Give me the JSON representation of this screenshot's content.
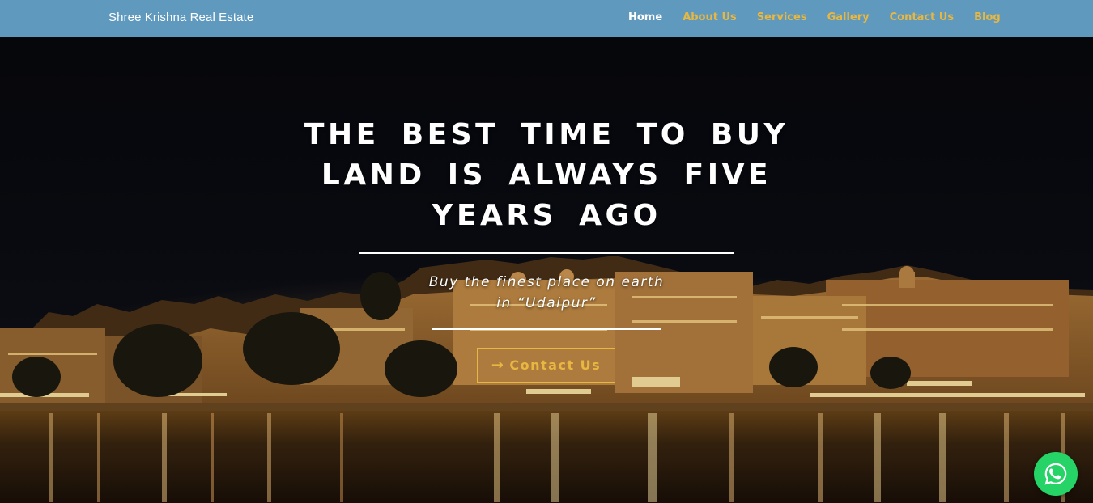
{
  "header": {
    "brand": "Shree Krishna Real Estate",
    "nav": [
      {
        "label": "Home",
        "active": true
      },
      {
        "label": "About Us",
        "active": false
      },
      {
        "label": "Services",
        "active": false
      },
      {
        "label": "Gallery",
        "active": false
      },
      {
        "label": "Contact Us",
        "active": false
      },
      {
        "label": "Blog",
        "active": false
      }
    ]
  },
  "hero": {
    "headline": "THE BEST TIME TO BUY LAND IS ALWAYS FIVE YEARS AGO",
    "subtitle": "Buy the finest place on earth in “Udaipur”",
    "cta_label": "Contact Us",
    "cta_icon": "arrow-right-icon"
  },
  "floating": {
    "icon": "whatsapp-icon"
  },
  "colors": {
    "header_bg": "#5f99bd",
    "accent": "#e8b741",
    "nav_active": "#ffffff",
    "whatsapp": "#25d366"
  }
}
